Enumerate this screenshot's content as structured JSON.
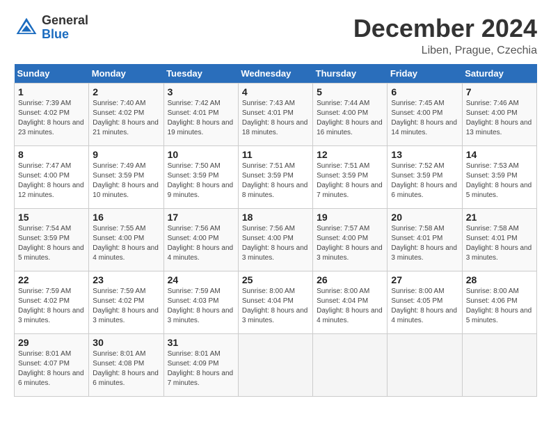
{
  "header": {
    "logo_general": "General",
    "logo_blue": "Blue",
    "title": "December 2024",
    "subtitle": "Liben, Prague, Czechia"
  },
  "weekdays": [
    "Sunday",
    "Monday",
    "Tuesday",
    "Wednesday",
    "Thursday",
    "Friday",
    "Saturday"
  ],
  "weeks": [
    [
      {
        "day": "1",
        "sunrise": "7:39 AM",
        "sunset": "4:02 PM",
        "daylight": "8 hours and 23 minutes."
      },
      {
        "day": "2",
        "sunrise": "7:40 AM",
        "sunset": "4:02 PM",
        "daylight": "8 hours and 21 minutes."
      },
      {
        "day": "3",
        "sunrise": "7:42 AM",
        "sunset": "4:01 PM",
        "daylight": "8 hours and 19 minutes."
      },
      {
        "day": "4",
        "sunrise": "7:43 AM",
        "sunset": "4:01 PM",
        "daylight": "8 hours and 18 minutes."
      },
      {
        "day": "5",
        "sunrise": "7:44 AM",
        "sunset": "4:00 PM",
        "daylight": "8 hours and 16 minutes."
      },
      {
        "day": "6",
        "sunrise": "7:45 AM",
        "sunset": "4:00 PM",
        "daylight": "8 hours and 14 minutes."
      },
      {
        "day": "7",
        "sunrise": "7:46 AM",
        "sunset": "4:00 PM",
        "daylight": "8 hours and 13 minutes."
      }
    ],
    [
      {
        "day": "8",
        "sunrise": "7:47 AM",
        "sunset": "4:00 PM",
        "daylight": "8 hours and 12 minutes."
      },
      {
        "day": "9",
        "sunrise": "7:49 AM",
        "sunset": "3:59 PM",
        "daylight": "8 hours and 10 minutes."
      },
      {
        "day": "10",
        "sunrise": "7:50 AM",
        "sunset": "3:59 PM",
        "daylight": "8 hours and 9 minutes."
      },
      {
        "day": "11",
        "sunrise": "7:51 AM",
        "sunset": "3:59 PM",
        "daylight": "8 hours and 8 minutes."
      },
      {
        "day": "12",
        "sunrise": "7:51 AM",
        "sunset": "3:59 PM",
        "daylight": "8 hours and 7 minutes."
      },
      {
        "day": "13",
        "sunrise": "7:52 AM",
        "sunset": "3:59 PM",
        "daylight": "8 hours and 6 minutes."
      },
      {
        "day": "14",
        "sunrise": "7:53 AM",
        "sunset": "3:59 PM",
        "daylight": "8 hours and 5 minutes."
      }
    ],
    [
      {
        "day": "15",
        "sunrise": "7:54 AM",
        "sunset": "3:59 PM",
        "daylight": "8 hours and 5 minutes."
      },
      {
        "day": "16",
        "sunrise": "7:55 AM",
        "sunset": "4:00 PM",
        "daylight": "8 hours and 4 minutes."
      },
      {
        "day": "17",
        "sunrise": "7:56 AM",
        "sunset": "4:00 PM",
        "daylight": "8 hours and 4 minutes."
      },
      {
        "day": "18",
        "sunrise": "7:56 AM",
        "sunset": "4:00 PM",
        "daylight": "8 hours and 3 minutes."
      },
      {
        "day": "19",
        "sunrise": "7:57 AM",
        "sunset": "4:00 PM",
        "daylight": "8 hours and 3 minutes."
      },
      {
        "day": "20",
        "sunrise": "7:58 AM",
        "sunset": "4:01 PM",
        "daylight": "8 hours and 3 minutes."
      },
      {
        "day": "21",
        "sunrise": "7:58 AM",
        "sunset": "4:01 PM",
        "daylight": "8 hours and 3 minutes."
      }
    ],
    [
      {
        "day": "22",
        "sunrise": "7:59 AM",
        "sunset": "4:02 PM",
        "daylight": "8 hours and 3 minutes."
      },
      {
        "day": "23",
        "sunrise": "7:59 AM",
        "sunset": "4:02 PM",
        "daylight": "8 hours and 3 minutes."
      },
      {
        "day": "24",
        "sunrise": "7:59 AM",
        "sunset": "4:03 PM",
        "daylight": "8 hours and 3 minutes."
      },
      {
        "day": "25",
        "sunrise": "8:00 AM",
        "sunset": "4:04 PM",
        "daylight": "8 hours and 3 minutes."
      },
      {
        "day": "26",
        "sunrise": "8:00 AM",
        "sunset": "4:04 PM",
        "daylight": "8 hours and 4 minutes."
      },
      {
        "day": "27",
        "sunrise": "8:00 AM",
        "sunset": "4:05 PM",
        "daylight": "8 hours and 4 minutes."
      },
      {
        "day": "28",
        "sunrise": "8:00 AM",
        "sunset": "4:06 PM",
        "daylight": "8 hours and 5 minutes."
      }
    ],
    [
      {
        "day": "29",
        "sunrise": "8:01 AM",
        "sunset": "4:07 PM",
        "daylight": "8 hours and 6 minutes."
      },
      {
        "day": "30",
        "sunrise": "8:01 AM",
        "sunset": "4:08 PM",
        "daylight": "8 hours and 6 minutes."
      },
      {
        "day": "31",
        "sunrise": "8:01 AM",
        "sunset": "4:09 PM",
        "daylight": "8 hours and 7 minutes."
      },
      null,
      null,
      null,
      null
    ]
  ]
}
